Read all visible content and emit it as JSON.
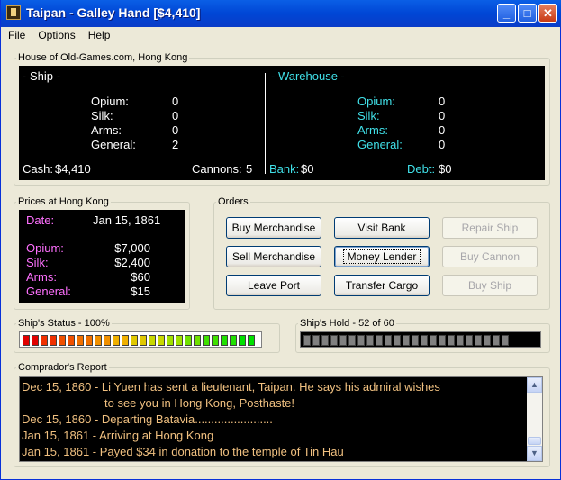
{
  "window": {
    "title": "Taipan - Galley Hand [$4,410]",
    "min_glyph": "_",
    "max_glyph": "□",
    "close_glyph": "✕"
  },
  "menu": [
    "File",
    "Options",
    "Help"
  ],
  "house": {
    "legend": "House of Old-Games.com, Hong Kong",
    "ship": {
      "heading": "- Ship -",
      "items": [
        {
          "label": "Opium:",
          "value": "0"
        },
        {
          "label": "Silk:",
          "value": "0"
        },
        {
          "label": "Arms:",
          "value": "0"
        },
        {
          "label": "General:",
          "value": "2"
        }
      ],
      "cash_label": "Cash:",
      "cash_value": "$4,410",
      "cannons_label": "Cannons:",
      "cannons_value": "5"
    },
    "warehouse": {
      "heading": "- Warehouse -",
      "items": [
        {
          "label": "Opium:",
          "value": "0"
        },
        {
          "label": "Silk:",
          "value": "0"
        },
        {
          "label": "Arms:",
          "value": "0"
        },
        {
          "label": "General:",
          "value": "0"
        }
      ],
      "bank_label": "Bank:",
      "bank_value": "$0",
      "debt_label": "Debt:",
      "debt_value": "$0"
    }
  },
  "prices": {
    "legend": "Prices at Hong Kong",
    "date_label": "Date:",
    "date_value": "Jan 15, 1861",
    "items": [
      {
        "label": "Opium:",
        "value": "$7,000"
      },
      {
        "label": "Silk:",
        "value": "$2,400"
      },
      {
        "label": "Arms:",
        "value": "$60"
      },
      {
        "label": "General:",
        "value": "$15"
      }
    ]
  },
  "orders": {
    "legend": "Orders",
    "buttons": [
      "Buy Merchandise",
      "Visit Bank",
      "Repair Ship",
      "Sell Merchandise",
      "Money Lender",
      "Buy Cannon",
      "Leave Port",
      "Transfer Cargo",
      "Buy Ship"
    ]
  },
  "status": {
    "legend": "Ship's Status - 100%",
    "fraction": 1.0,
    "segments": 26,
    "colors": [
      "#e00000",
      "#f03000",
      "#f05000",
      "#f07000",
      "#f09000",
      "#f0b000",
      "#e0c800",
      "#c8d800",
      "#a0e000",
      "#70e000",
      "#40e000",
      "#20e000",
      "#00e000"
    ]
  },
  "hold": {
    "legend": "Ship's Hold - 52 of 60",
    "used": 52,
    "capacity": 60,
    "segments": 26,
    "color": "#808080"
  },
  "report": {
    "legend": "Comprador's Report",
    "lines": [
      "Dec 15, 1860 - Li Yuen has sent a lieutenant, Taipan.  He says his admiral wishes",
      "to see you in Hong Kong, Posthaste!",
      "Dec 15, 1860 - Departing Batavia........................",
      "Jan 15, 1861 - Arriving at Hong Kong",
      "Jan 15, 1861 - Payed $34 in donation to the temple of Tin Hau"
    ]
  }
}
